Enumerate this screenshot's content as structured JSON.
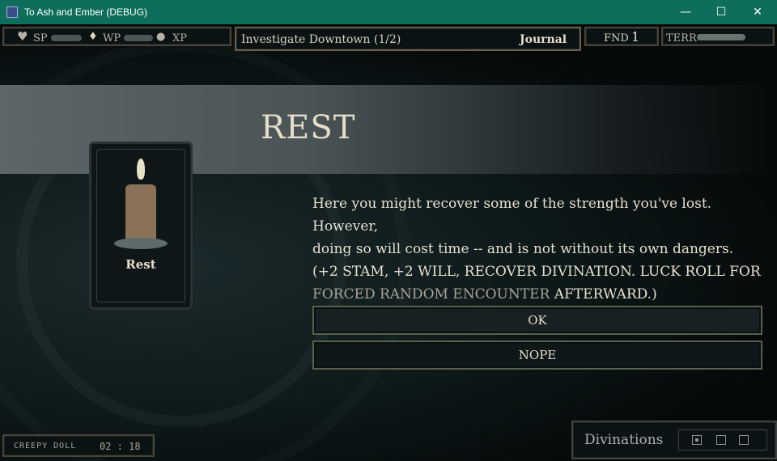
{
  "window": {
    "title": "To Ash and Ember (DEBUG)",
    "minimize": "—",
    "maximize": "☐",
    "close": "✕"
  },
  "hud": {
    "sp_label": "SP",
    "wp_label": "WP",
    "xp_label": "XP",
    "quest": "Investigate Downtown (1/2)",
    "journal": "Journal",
    "fnd_label": "FND",
    "fnd_value": "1",
    "terr_label": "TERR"
  },
  "event": {
    "title": "REST",
    "card_label": "Rest",
    "description_line1": "Here you might recover some of the strength you've lost. However,",
    "description_line2": "doing so will cost time -- and is not without its own dangers.",
    "description_line3": "(+2 STAM, +2 WILL, RECOVER DIVINATION. LUCK ROLL FOR",
    "description_line4a": "FORCED RANDOM ENCOUNTER",
    "description_line4b": " AFTERWARD.)",
    "ok": "OK",
    "nope": "NOPE"
  },
  "footer": {
    "doll": "CREEPY DOLL",
    "time": "02 : 18",
    "divinations": "Divinations"
  }
}
